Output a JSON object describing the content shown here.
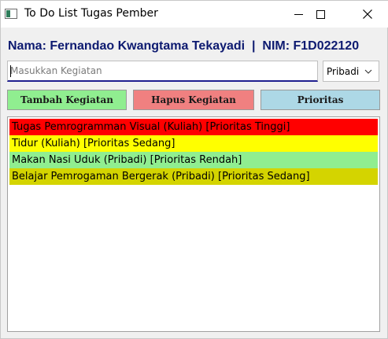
{
  "window": {
    "title": "To Do List Tugas Pember",
    "icon": "app-window-icon",
    "controls": {
      "minimize": "minimize-icon",
      "maximize": "maximize-icon",
      "close": "close-icon"
    }
  },
  "header": {
    "label": "Nama: Fernandao Kwangtama Tekayadi  |  NIM: F1D022120"
  },
  "form": {
    "input_placeholder": "Masukkan Kegiatan",
    "input_value": "",
    "category_selected": "Pribadi"
  },
  "buttons": {
    "add_label": "Tambah Kegiatan",
    "delete_label": "Hapus Kegiatan",
    "priority_label": "Prioritas",
    "add_color": "#90ee90",
    "delete_color": "#f08080",
    "priority_color": "#add8e6"
  },
  "tasks": [
    {
      "text": "Tugas Pemrogramman Visual (Kuliah) [Prioritas Tinggi]",
      "color": "#ff0000"
    },
    {
      "text": "Tidur (Kuliah) [Prioritas Sedang]",
      "color": "#ffff00"
    },
    {
      "text": "Makan Nasi Uduk (Pribadi) [Prioritas Rendah]",
      "color": "#90ee90"
    },
    {
      "text": "Belajar Pemrogaman Bergerak (Pribadi) [Prioritas Sedang]",
      "color": "#d4d400"
    }
  ]
}
